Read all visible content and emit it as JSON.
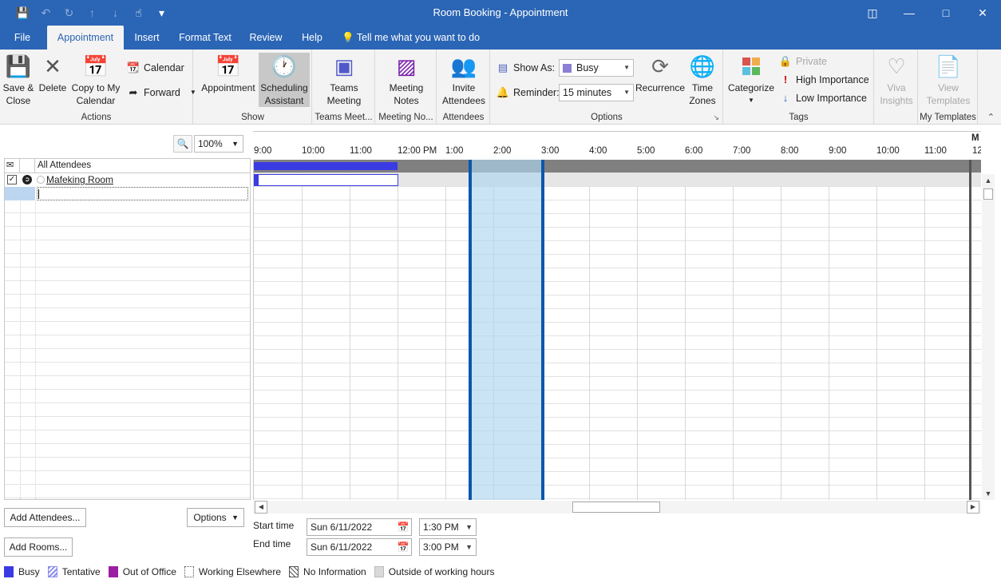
{
  "window": {
    "title": "Room Booking  -  Appointment"
  },
  "tabs": [
    {
      "label": "File"
    },
    {
      "label": "Appointment"
    },
    {
      "label": "Insert"
    },
    {
      "label": "Format Text"
    },
    {
      "label": "Review"
    },
    {
      "label": "Help"
    }
  ],
  "tell_me": "Tell me what you want to do",
  "ribbon": {
    "actions": {
      "label": "Actions",
      "save_close": "Save &\nClose",
      "delete": "Delete",
      "copy_calendar": "Copy to My\nCalendar",
      "calendar": "Calendar",
      "forward": "Forward"
    },
    "show": {
      "label": "Show",
      "appointment": "Appointment",
      "scheduling": "Scheduling\nAssistant"
    },
    "teams": {
      "label": "Teams Meet...",
      "btn": "Teams\nMeeting"
    },
    "notes": {
      "label": "Meeting No...",
      "btn": "Meeting\nNotes"
    },
    "attendees": {
      "label": "Attendees",
      "btn": "Invite\nAttendees"
    },
    "options": {
      "label": "Options",
      "show_as_label": "Show As:",
      "show_as_value": "Busy",
      "reminder_label": "Reminder:",
      "reminder_value": "15 minutes",
      "recurrence": "Recurrence",
      "time_zones": "Time\nZones"
    },
    "tags": {
      "label": "Tags",
      "categorize": "Categorize",
      "private": "Private",
      "high": "High Importance",
      "low": "Low Importance"
    },
    "viva": {
      "btn": "Viva\nInsights"
    },
    "templates": {
      "label": "My Templates",
      "btn": "View\nTemplates"
    }
  },
  "zoom": "100%",
  "attendees_pane": {
    "header": "All Attendees",
    "rows": [
      {
        "name": "Mafeking Room"
      }
    ]
  },
  "time_header": {
    "day_initial": "M",
    "labels": [
      "9:00",
      "10:00",
      "11:00",
      "12:00 PM",
      "1:00",
      "2:00",
      "3:00",
      "4:00",
      "5:00",
      "6:00",
      "7:00",
      "8:00",
      "9:00",
      "10:00",
      "11:00",
      "12"
    ]
  },
  "buttons": {
    "add_attendees": "Add Attendees...",
    "options": "Options",
    "add_rooms": "Add Rooms..."
  },
  "times": {
    "start_label": "Start time",
    "start_date": "Sun 6/11/2022",
    "start_time": "1:30 PM",
    "end_label": "End time",
    "end_date": "Sun 6/11/2022",
    "end_time": "3:00 PM"
  },
  "legend": [
    {
      "label": "Busy",
      "color": "#3b3be3"
    },
    {
      "label": "Tentative",
      "color": "#8b8bea"
    },
    {
      "label": "Out of Office",
      "color": "#9b1fa3"
    },
    {
      "label": "Working Elsewhere",
      "color": "#ffffff"
    },
    {
      "label": "No Information",
      "color": "#ffffff"
    },
    {
      "label": "Outside of working hours",
      "color": "#d9d9d9"
    }
  ]
}
